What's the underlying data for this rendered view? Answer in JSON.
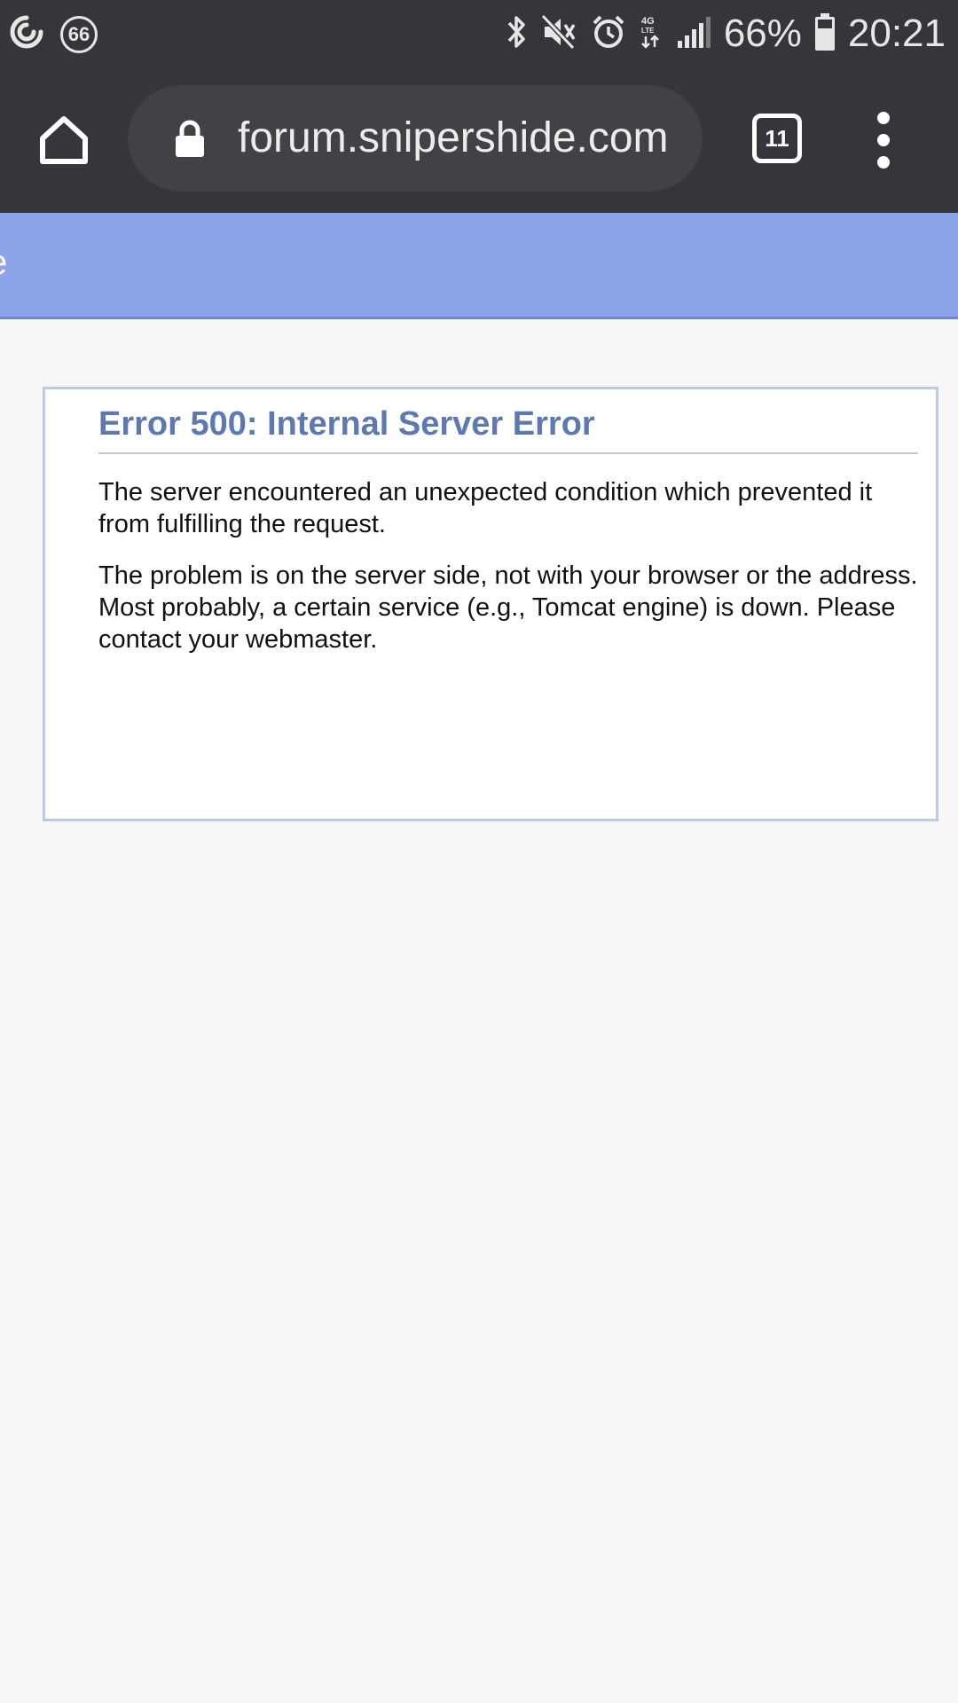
{
  "status_bar": {
    "notification_badge": "66",
    "battery_percent": "66%",
    "time": "20:21",
    "network_label": "4G LTE",
    "icons": [
      "sync-icon",
      "notification-badge-icon",
      "bluetooth-icon",
      "mute-icon",
      "alarm-icon",
      "network-4g-icon",
      "signal-icon",
      "battery-icon"
    ]
  },
  "browser": {
    "url": "forum.snipershide.com",
    "tab_count": "11",
    "icons": [
      "home-icon",
      "lock-icon",
      "tabs-icon",
      "more-menu-icon"
    ]
  },
  "header": {
    "edge_text": "e",
    "color": "#8ba4ea"
  },
  "error": {
    "title": "Error 500: Internal Server Error",
    "paragraph_1": "The server encountered an unexpected condition which prevented it from fulfilling the request.",
    "paragraph_2": "The problem is on the server side, not with your browser or the address. Most probably, a certain service (e.g., Tomcat engine) is down. Please contact your webmaster.",
    "title_color": "#5e78b0"
  }
}
